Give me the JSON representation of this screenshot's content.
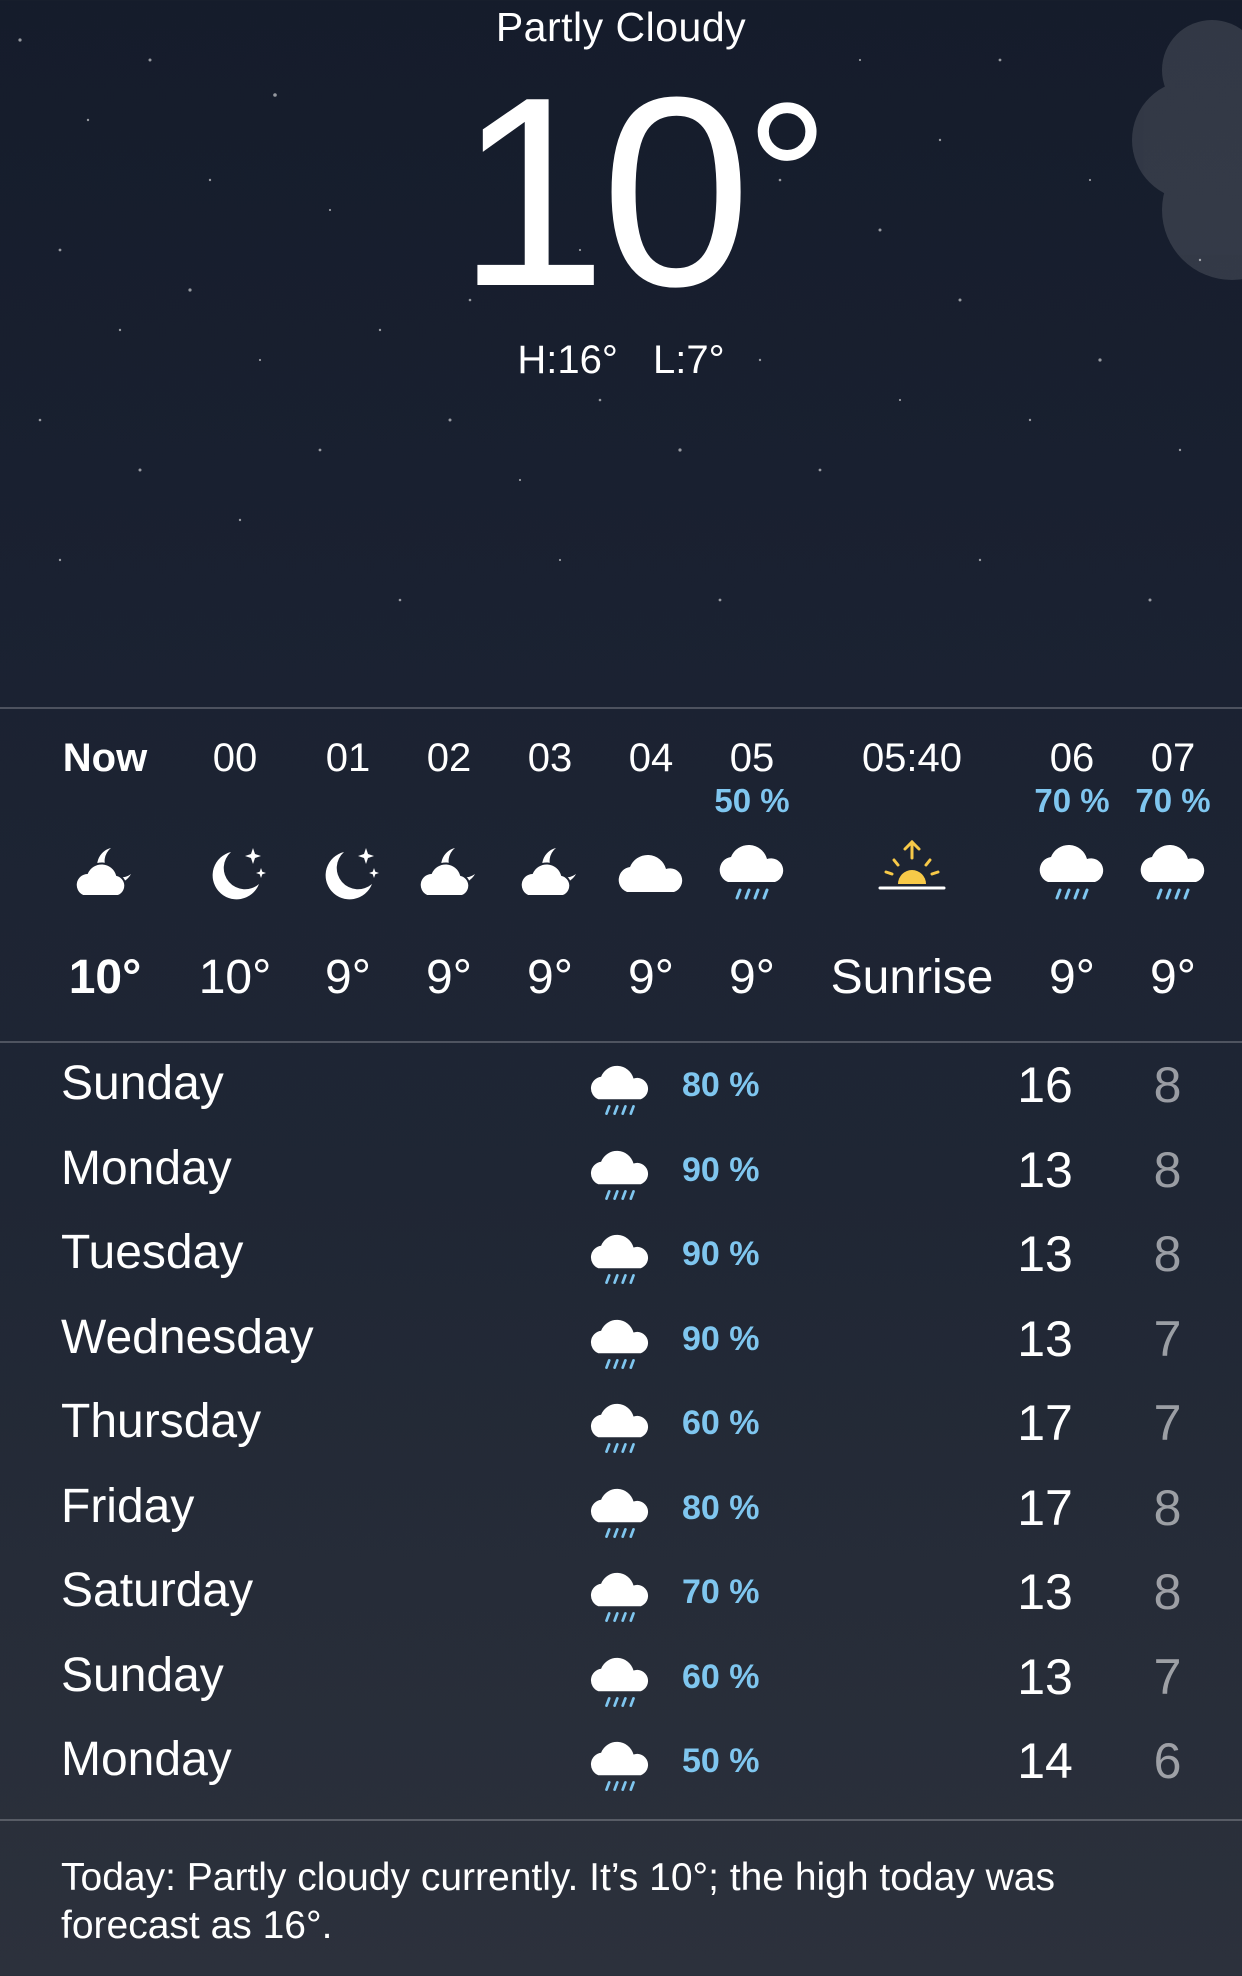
{
  "current": {
    "condition": "Partly Cloudy",
    "temperature": "10",
    "degree_symbol": "°",
    "high": "H:16°",
    "low": "L:7°"
  },
  "hourly": [
    {
      "time": "Now",
      "pop": "",
      "icon": "cloud-moon-icon",
      "temp": "10°"
    },
    {
      "time": "00",
      "pop": "",
      "icon": "moon-stars-icon",
      "temp": "10°"
    },
    {
      "time": "01",
      "pop": "",
      "icon": "moon-stars-icon",
      "temp": "9°"
    },
    {
      "time": "02",
      "pop": "",
      "icon": "cloud-moon-icon",
      "temp": "9°"
    },
    {
      "time": "03",
      "pop": "",
      "icon": "cloud-moon-icon",
      "temp": "9°"
    },
    {
      "time": "04",
      "pop": "",
      "icon": "cloud-icon",
      "temp": "9°"
    },
    {
      "time": "05",
      "pop": "50 %",
      "icon": "cloud-rain-icon",
      "temp": "9°"
    },
    {
      "time": "05:40",
      "pop": "",
      "icon": "sunrise-icon",
      "temp": "Sunrise"
    },
    {
      "time": "06",
      "pop": "70 %",
      "icon": "cloud-rain-icon",
      "temp": "9°"
    },
    {
      "time": "07",
      "pop": "70 %",
      "icon": "cloud-rain-icon",
      "temp": "9°"
    }
  ],
  "daily": [
    {
      "day": "Sunday",
      "icon": "cloud-rain-icon",
      "pop": "80 %",
      "high": "16",
      "low": "8"
    },
    {
      "day": "Monday",
      "icon": "cloud-rain-icon",
      "pop": "90 %",
      "high": "13",
      "low": "8"
    },
    {
      "day": "Tuesday",
      "icon": "cloud-rain-icon",
      "pop": "90 %",
      "high": "13",
      "low": "8"
    },
    {
      "day": "Wednesday",
      "icon": "cloud-rain-icon",
      "pop": "90 %",
      "high": "13",
      "low": "7"
    },
    {
      "day": "Thursday",
      "icon": "cloud-rain-icon",
      "pop": "60 %",
      "high": "17",
      "low": "7"
    },
    {
      "day": "Friday",
      "icon": "cloud-rain-icon",
      "pop": "80 %",
      "high": "17",
      "low": "8"
    },
    {
      "day": "Saturday",
      "icon": "cloud-rain-icon",
      "pop": "70 %",
      "high": "13",
      "low": "8"
    },
    {
      "day": "Sunday",
      "icon": "cloud-rain-icon",
      "pop": "60 %",
      "high": "13",
      "low": "7"
    },
    {
      "day": "Monday",
      "icon": "cloud-rain-icon",
      "pop": "50 %",
      "high": "14",
      "low": "6"
    }
  ],
  "summary": "Today: Partly cloudy currently. It’s 10°; the high today was forecast as 16°.",
  "colors": {
    "precipitation": "#7fc6ef",
    "sun": "#f7c948",
    "background_top": "#151c2b",
    "background_bottom": "#2c313c"
  }
}
